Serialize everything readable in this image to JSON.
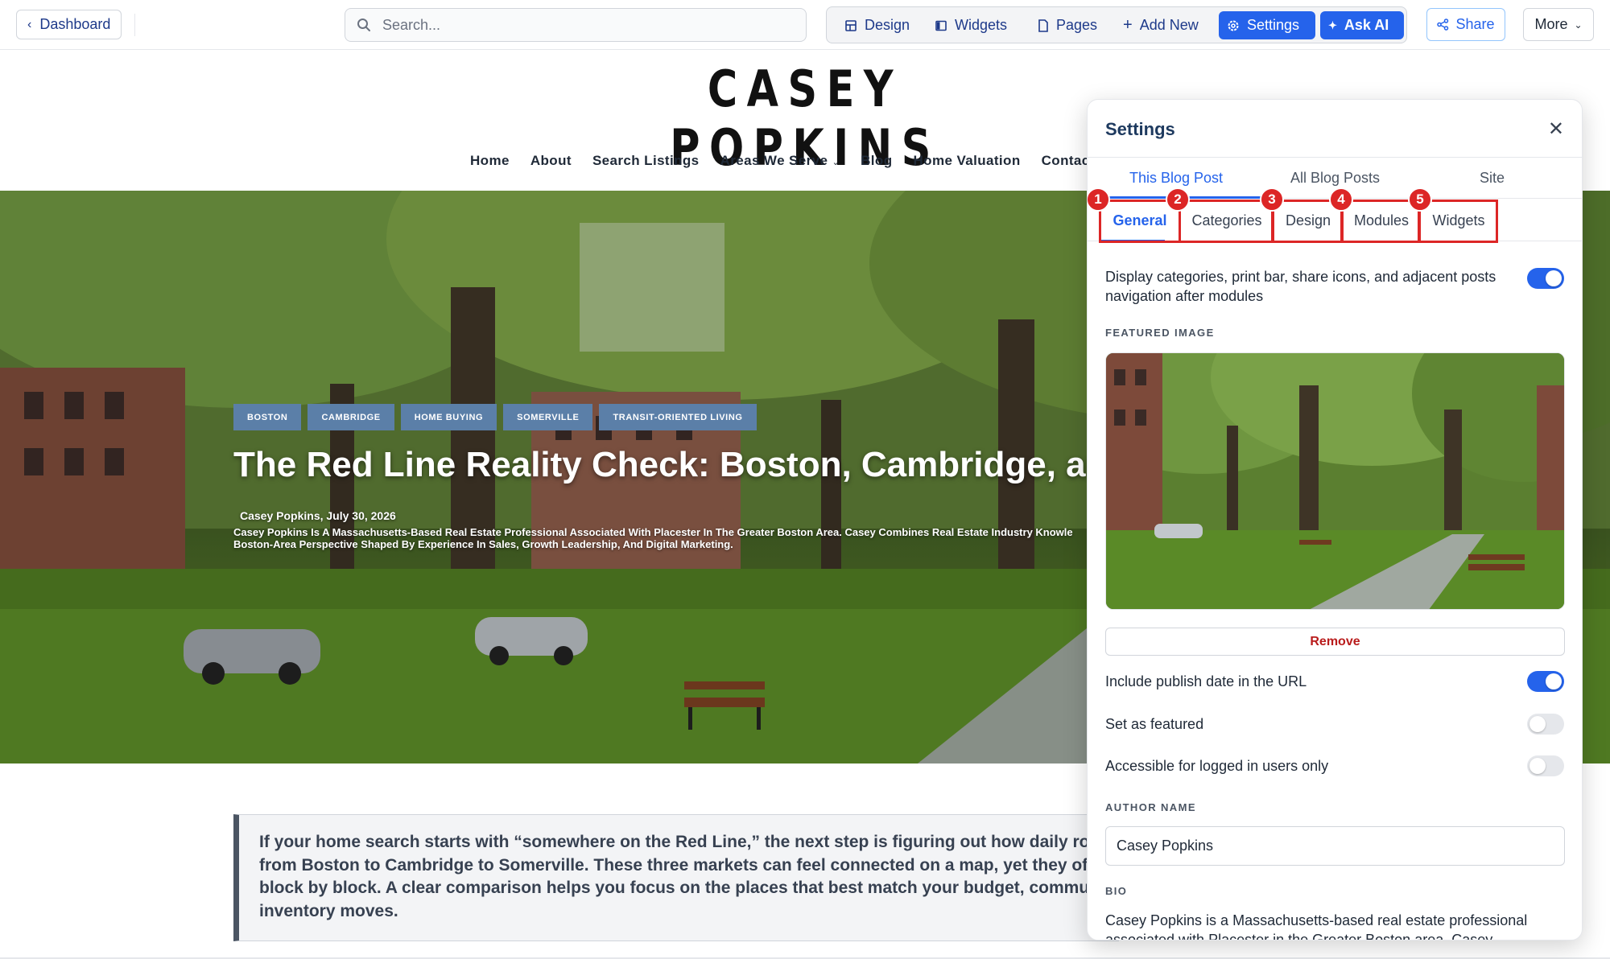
{
  "toolbar": {
    "dashboard_label": "Dashboard",
    "search_placeholder": "Search...",
    "tools": {
      "design": "Design",
      "widgets": "Widgets",
      "pages": "Pages",
      "add_new": "Add New",
      "settings": "Settings",
      "ask_ai": "Ask AI"
    },
    "share_label": "Share",
    "more_label": "More"
  },
  "site": {
    "title": "CASEY POPKINS",
    "nav": [
      "Home",
      "About",
      "Search Listings",
      "Areas We Serve",
      "Blog",
      "Home Valuation",
      "Contact"
    ]
  },
  "post": {
    "tags": [
      "BOSTON",
      "CAMBRIDGE",
      "HOME BUYING",
      "SOMERVILLE",
      "TRANSIT-ORIENTED LIVING"
    ],
    "title": "The Red Line Reality Check: Boston, Cambridge, and Som",
    "byline": "Casey Popkins,  July 30, 2026",
    "bio_lines": [
      "Casey Popkins Is A Massachusetts-Based Real Estate Professional Associated With Placester In The Greater Boston Area. Casey Combines Real Estate Industry Knowle",
      "Boston-Area Perspective Shaped By Experience In Sales, Growth Leadership, And Digital Marketing."
    ],
    "intro_lines": [
      "If your home search starts with “somewhere on the Red Line,” the next step is figuring out how daily routines,",
      "from Boston to Cambridge to Somerville. These three markets can feel connected on a map, yet they often deli",
      "block by block. A clear comparison helps you focus on the places that best match your budget, commute, and n",
      "inventory moves."
    ]
  },
  "settings_panel": {
    "title": "Settings",
    "scope_tabs": [
      "This Blog Post",
      "All Blog Posts",
      "Site"
    ],
    "sub_tabs": [
      "General",
      "Categories",
      "Design",
      "Modules",
      "Widgets"
    ],
    "badges": [
      "1",
      "2",
      "3",
      "4",
      "5"
    ],
    "display_option_label": "Display categories, print bar, share icons, and adjacent posts navigation after modules",
    "display_option_on": true,
    "featured_image_label": "FEATURED IMAGE",
    "remove_label": "Remove",
    "include_date_label": "Include publish date in the URL",
    "include_date_on": true,
    "featured_label": "Set as featured",
    "featured_on": false,
    "logged_in_label": "Accessible for logged in users only",
    "logged_in_on": false,
    "author_name_label": "AUTHOR NAME",
    "author_name_value": "Casey Popkins",
    "bio_label": "BIO",
    "bio_value": "Casey Popkins is a Massachusetts-based real estate professional associated with Placester in the Greater Boston area. Casey"
  },
  "colors": {
    "accent": "#2563eb",
    "highlight": "#dc2626",
    "tag_bg": "#5b7fa8"
  }
}
